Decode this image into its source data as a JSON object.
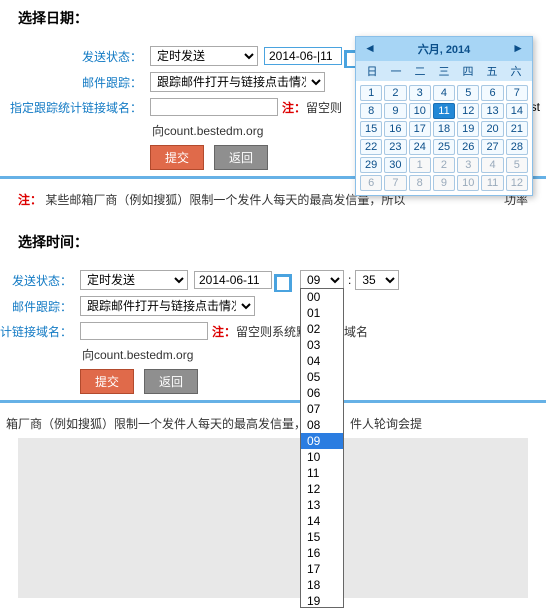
{
  "titles": {
    "date": "选择日期：",
    "time": "选择时间："
  },
  "labels": {
    "send_state": "发送状态：",
    "mail_track": "邮件跟踪：",
    "domain": "指定跟踪统计链接域名：",
    "domain_short": "计链接域名：",
    "note_prefix": "注：",
    "leave_blank": "留空则",
    "leave_blank_long": "留空则系统默认随机域名",
    "best": "best",
    "suffix": "向count.bestedm.org",
    "colon": ":"
  },
  "selects": {
    "send_state_value": "定时发送",
    "track_value": "跟踪邮件打开与链接点击情况",
    "hour_value": "09",
    "min_value": "35"
  },
  "inputs": {
    "date_value": "2014-06-11",
    "date_value_cursor": "2014-06-|11",
    "domain_value": ""
  },
  "buttons": {
    "submit": "提交",
    "back": "返回"
  },
  "footnote": {
    "main": "某些邮箱厂商（例如搜狐）限制一个发件人每天的最高发信量，所以",
    "main2": "箱厂商（例如搜狐）限制一个发件人每天的最高发信量，所以",
    "tail": "功率",
    "tail2": "件人轮询会提"
  },
  "calendar": {
    "title": "六月,  2014",
    "dow": [
      "日",
      "一",
      "二",
      "三",
      "四",
      "五",
      "六"
    ],
    "cells": [
      {
        "n": "1"
      },
      {
        "n": "2"
      },
      {
        "n": "3"
      },
      {
        "n": "4"
      },
      {
        "n": "5"
      },
      {
        "n": "6"
      },
      {
        "n": "7"
      },
      {
        "n": "8"
      },
      {
        "n": "9"
      },
      {
        "n": "10"
      },
      {
        "n": "11",
        "sel": true
      },
      {
        "n": "12"
      },
      {
        "n": "13"
      },
      {
        "n": "14"
      },
      {
        "n": "15"
      },
      {
        "n": "16"
      },
      {
        "n": "17"
      },
      {
        "n": "18"
      },
      {
        "n": "19"
      },
      {
        "n": "20"
      },
      {
        "n": "21"
      },
      {
        "n": "22"
      },
      {
        "n": "23"
      },
      {
        "n": "24"
      },
      {
        "n": "25"
      },
      {
        "n": "26"
      },
      {
        "n": "27"
      },
      {
        "n": "28"
      },
      {
        "n": "29"
      },
      {
        "n": "30"
      },
      {
        "n": "1",
        "other": true
      },
      {
        "n": "2",
        "other": true
      },
      {
        "n": "3",
        "other": true
      },
      {
        "n": "4",
        "other": true
      },
      {
        "n": "5",
        "other": true
      },
      {
        "n": "6",
        "other": true
      },
      {
        "n": "7",
        "other": true
      },
      {
        "n": "8",
        "other": true
      },
      {
        "n": "9",
        "other": true
      },
      {
        "n": "10",
        "other": true
      },
      {
        "n": "11",
        "other": true
      },
      {
        "n": "12",
        "other": true
      }
    ]
  },
  "hours": [
    "00",
    "01",
    "02",
    "03",
    "04",
    "05",
    "06",
    "07",
    "08",
    "09",
    "10",
    "11",
    "12",
    "13",
    "14",
    "15",
    "16",
    "17",
    "18",
    "19"
  ],
  "hour_selected": "09"
}
